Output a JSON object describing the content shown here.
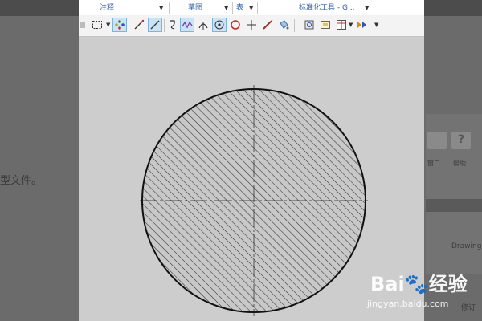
{
  "background_page": {
    "left_text": "型文件。",
    "right_labels": {
      "window": "窗口",
      "help": "帮助",
      "drawing": "Drawing",
      "bottom": "修订"
    }
  },
  "ribbon_groups": [
    {
      "label": "注释"
    },
    {
      "label": "草图"
    },
    {
      "label": "表"
    },
    {
      "label": "标准化工具 - G..."
    }
  ],
  "toolbar": {
    "icons": [
      "partial-icon",
      "box-select-icon",
      "smart-select-icon",
      "line-icon",
      "centerline-icon",
      "spline-icon",
      "curve-icon",
      "tangent-arc-icon",
      "point-icon",
      "circle-icon",
      "cross-icon",
      "pencil-icon",
      "fill-icon",
      "view-icon",
      "frame-icon",
      "table-icon",
      "format-icon"
    ]
  },
  "drawing": {
    "shape": "circle",
    "hatch": "diagonal hatch",
    "centerlines": true
  },
  "watermark": {
    "logo": "Bai🐾经验",
    "url": "jingyan.baidu.com"
  },
  "colors": {
    "group_label": "#2a5fa8",
    "canvas": "#cdcdcd",
    "active_tool": "#c9e4f6",
    "hatch_fill": "#c8c8c8"
  }
}
